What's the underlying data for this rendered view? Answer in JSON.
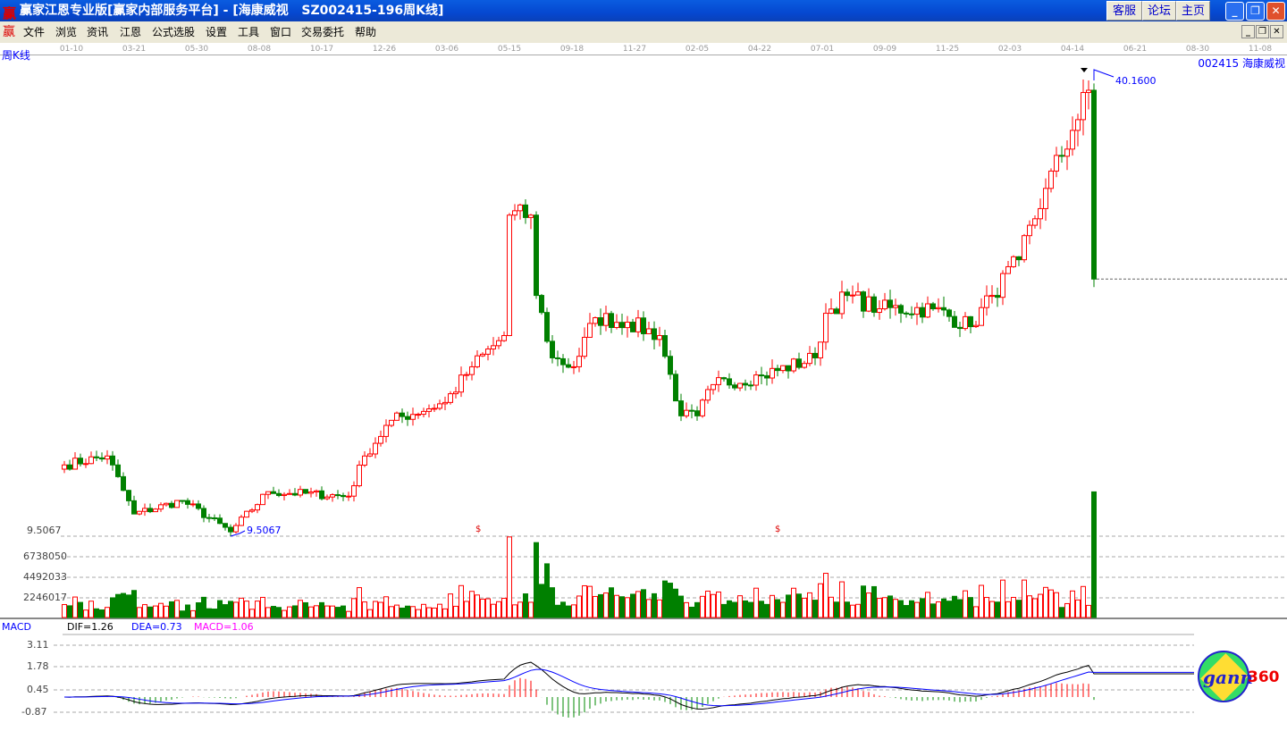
{
  "window": {
    "title": "赢家江恩专业版[赢家内部服务平台] - [海康威视   SZ002415-196周K线]",
    "buttons": [
      "客服",
      "论坛",
      "主页"
    ]
  },
  "menu": [
    "文件",
    "浏览",
    "资讯",
    "江恩",
    "公式选股",
    "设置",
    "工具",
    "窗口",
    "交易委托",
    "帮助"
  ],
  "dates": [
    "01-10",
    "03-21",
    "05-30",
    "08-08",
    "10-17",
    "12-26",
    "03-06",
    "05-15",
    "09-18",
    "11-27",
    "02-05",
    "04-22",
    "07-01",
    "09-09",
    "11-25",
    "02-03",
    "04-14",
    "06-21",
    "08-30",
    "11-08"
  ],
  "chart": {
    "period": "周K线",
    "stock": "002415  海康威视",
    "high_label": "40.1600",
    "low_label": "9.5067",
    "low_axis": "9.5067",
    "marker": "$"
  },
  "volume_axis": [
    "6738050",
    "4492033",
    "2246017"
  ],
  "macd": {
    "name": "MACD",
    "dif": "DIF=1.26",
    "dea": "DEA=0.73",
    "macd": "MACD=1.06",
    "axis": [
      "3.11",
      "1.78",
      "0.45",
      "-0.87"
    ]
  },
  "logo": "gann360",
  "chart_data": {
    "type": "candlestick",
    "price_range": [
      9.5067,
      40.16
    ],
    "candle_count": 193,
    "close_keypoints": [
      [
        0,
        14.3
      ],
      [
        8,
        14.9
      ],
      [
        13,
        11
      ],
      [
        22,
        11.9
      ],
      [
        31,
        9.8
      ],
      [
        38,
        12.5
      ],
      [
        53,
        12.2
      ],
      [
        56,
        14.9
      ],
      [
        61,
        17.3
      ],
      [
        71,
        18.5
      ],
      [
        76,
        20.9
      ],
      [
        82,
        23
      ],
      [
        83,
        31.1
      ],
      [
        87,
        31.1
      ],
      [
        88,
        25.7
      ],
      [
        91,
        21.5
      ],
      [
        95,
        20.9
      ],
      [
        99,
        24.2
      ],
      [
        105,
        23.9
      ],
      [
        111,
        23
      ],
      [
        115,
        17.6
      ],
      [
        118,
        17.6
      ],
      [
        121,
        19.7
      ],
      [
        130,
        20.3
      ],
      [
        140,
        21.5
      ],
      [
        142,
        24.5
      ],
      [
        146,
        25.7
      ],
      [
        152,
        24.8
      ],
      [
        162,
        24.8
      ],
      [
        169,
        23.6
      ],
      [
        173,
        25.7
      ],
      [
        178,
        28.1
      ],
      [
        183,
        32.9
      ],
      [
        188,
        36.8
      ],
      [
        191,
        39.5
      ],
      [
        192,
        26.8
      ]
    ],
    "colors": {
      "up": "#ff0000",
      "down": "#008000",
      "dif": "#000000",
      "dea": "#0000ff"
    }
  }
}
